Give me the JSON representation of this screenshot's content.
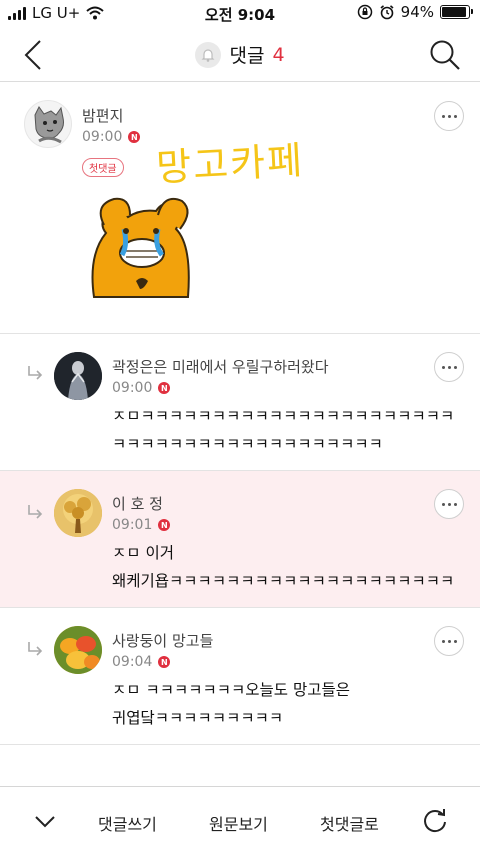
{
  "status_bar": {
    "carrier": "LG U+",
    "time": "오전 9:04",
    "battery": "94%",
    "battery_level": 0.94
  },
  "header": {
    "title": "댓글",
    "count": "4"
  },
  "comments": [
    {
      "author": "밤편지",
      "time": "09:00",
      "new_badge": "N",
      "first_badge": "첫댓글",
      "sticker_text": "망고카페",
      "avatar": "doodle-cat-avatar"
    },
    {
      "author": "곽정은은 미래에서 우릴구하러왔다",
      "time": "09:00",
      "new_badge": "N",
      "text": "ㅈㅁㅋㅋㅋㅋㅋㅋㅋㅋㅋㅋㅋㅋㅋㅋㅋㅋㅋㅋㅋㅋㅋㅋㅋㅋㅋㅋㅋㅋㅋㅋㅋㅋㅋㅋㅋㅋㅋㅋㅋㅋㅋ",
      "avatar": "dark-figure-avatar"
    },
    {
      "author": "이 호 정",
      "time": "09:01",
      "new_badge": "N",
      "text_line1": "ㅈㅁ 이거",
      "text_line2": "왜케기욥ㅋㅋㅋㅋㅋㅋㅋㅋㅋㅋㅋㅋㅋㅋㅋㅋㅋㅋㅋㅋ",
      "avatar": "golden-tree-avatar"
    },
    {
      "author": "사랑둥이 망고들",
      "time": "09:04",
      "new_badge": "N",
      "text_line1": "ㅈㅁ ㅋㅋㅋㅋㅋㅋㅋ오늘도 망고들은",
      "text_line2": "귀엽닼ㅋㅋㅋㅋㅋㅋㅋㅋㅋ",
      "avatar": "mangoes-avatar"
    }
  ],
  "bottom_bar": {
    "write": "댓글쓰기",
    "view_original": "원문보기",
    "first_comment": "첫댓글로"
  },
  "colors": {
    "accent": "#e0303f",
    "highlight_bg": "#fdeef0",
    "sticker_yellow": "#f5c518",
    "character_orange": "#f2a20c"
  }
}
